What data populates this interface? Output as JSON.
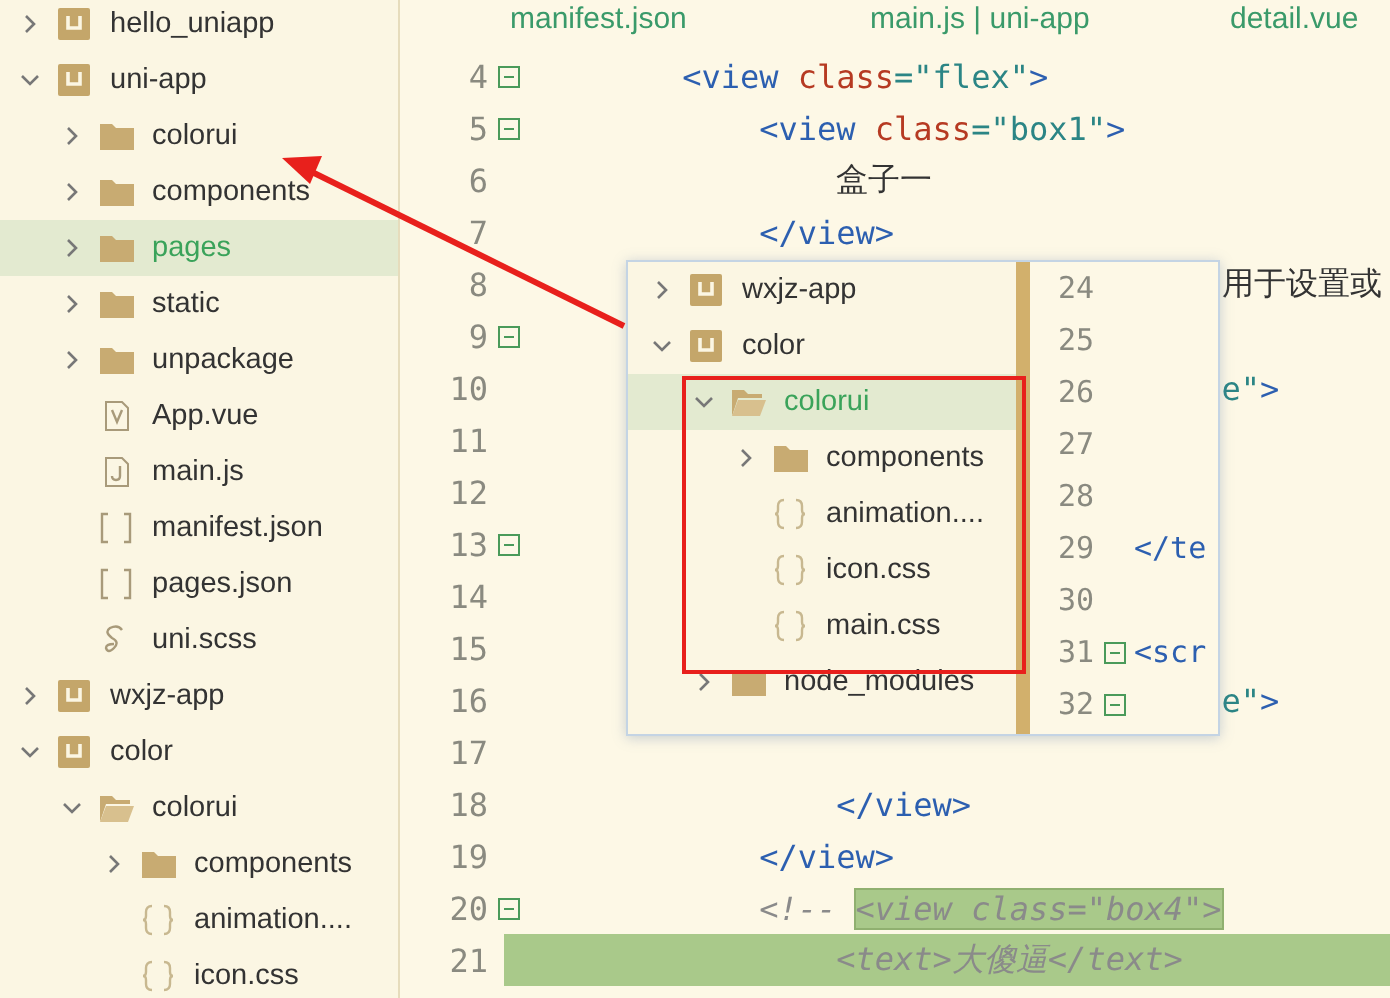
{
  "sidebar": {
    "tree": [
      {
        "label": "hello_uniapp",
        "kind": "project",
        "expanded": false,
        "selected": false
      },
      {
        "label": "uni-app",
        "kind": "project",
        "expanded": true,
        "selected": false,
        "children": [
          {
            "label": "colorui",
            "kind": "folder",
            "expanded": false,
            "selected": false
          },
          {
            "label": "components",
            "kind": "folder",
            "expanded": false,
            "selected": false
          },
          {
            "label": "pages",
            "kind": "folder",
            "expanded": false,
            "selected": true
          },
          {
            "label": "static",
            "kind": "folder",
            "expanded": false,
            "selected": false
          },
          {
            "label": "unpackage",
            "kind": "folder",
            "expanded": false,
            "selected": false
          },
          {
            "label": "App.vue",
            "kind": "vue",
            "selected": false
          },
          {
            "label": "main.js",
            "kind": "js",
            "selected": false
          },
          {
            "label": "manifest.json",
            "kind": "json",
            "selected": false
          },
          {
            "label": "pages.json",
            "kind": "json",
            "selected": false
          },
          {
            "label": "uni.scss",
            "kind": "scss",
            "selected": false
          }
        ]
      },
      {
        "label": "wxjz-app",
        "kind": "project",
        "expanded": false,
        "selected": false
      },
      {
        "label": "color",
        "kind": "project",
        "expanded": true,
        "selected": false,
        "children": [
          {
            "label": "colorui",
            "kind": "folder",
            "expanded": true,
            "selected": false,
            "children": [
              {
                "label": "components",
                "kind": "folder",
                "expanded": false,
                "selected": false
              },
              {
                "label": "animation....",
                "kind": "css",
                "selected": false
              },
              {
                "label": "icon.css",
                "kind": "css",
                "selected": false
              }
            ]
          }
        ]
      }
    ]
  },
  "editor": {
    "tabs": [
      {
        "label": "manifest.json"
      },
      {
        "label": "main.js | uni-app"
      },
      {
        "label": "detail.vue"
      }
    ],
    "lines": [
      {
        "number": "4",
        "fold": true,
        "tokens": [
          {
            "kind": "tag",
            "text": "        <view "
          },
          {
            "kind": "attr",
            "text": "class"
          },
          {
            "kind": "str",
            "text": "=\"flex\""
          },
          {
            "kind": "tag",
            "text": ">"
          }
        ]
      },
      {
        "number": "5",
        "fold": true,
        "tokens": [
          {
            "kind": "tag",
            "text": "            <view "
          },
          {
            "kind": "attr",
            "text": "class"
          },
          {
            "kind": "str",
            "text": "=\"box1\""
          },
          {
            "kind": "tag",
            "text": ">"
          }
        ]
      },
      {
        "number": "6",
        "fold": false,
        "tokens": [
          {
            "kind": "text",
            "text": "                盒子一"
          }
        ]
      },
      {
        "number": "7",
        "fold": false,
        "tokens": [
          {
            "kind": "tag",
            "text": "            </view>"
          }
        ]
      },
      {
        "number": "8",
        "fold": false,
        "tokens": [
          {
            "kind": "text",
            "text": "                                    用于设置或"
          }
        ]
      },
      {
        "number": "9",
        "fold": true
      },
      {
        "number": "10",
        "fold": false,
        "tokens": [
          {
            "kind": "str",
            "text": "                                    e\""
          },
          {
            "kind": "tag",
            "text": ">"
          }
        ]
      },
      {
        "number": "11",
        "fold": false
      },
      {
        "number": "12",
        "fold": false
      },
      {
        "number": "13",
        "fold": true
      },
      {
        "number": "14",
        "fold": false
      },
      {
        "number": "15",
        "fold": false
      },
      {
        "number": "16",
        "fold": false,
        "tokens": [
          {
            "kind": "str",
            "text": "                                    e\""
          },
          {
            "kind": "tag",
            "text": ">"
          }
        ]
      },
      {
        "number": "17",
        "fold": false
      },
      {
        "number": "18",
        "fold": false,
        "tokens": [
          {
            "kind": "tag",
            "text": "                </view>"
          }
        ]
      },
      {
        "number": "19",
        "fold": false,
        "tokens": [
          {
            "kind": "tag",
            "text": "            </view>"
          }
        ]
      },
      {
        "number": "20",
        "fold": true,
        "tokens": [
          {
            "kind": "comment",
            "text": "            <!-- "
          },
          {
            "kind": "comment-mark",
            "text": "<view class=\"box4\">"
          }
        ]
      },
      {
        "number": "21",
        "fold": false,
        "highlight": true,
        "tokens": [
          {
            "kind": "comment",
            "text": "                <text>大傻逼</text>"
          }
        ]
      }
    ]
  },
  "popup": {
    "tree": [
      {
        "label": "wxjz-app",
        "kind": "project",
        "expanded": false,
        "selected": false
      },
      {
        "label": "color",
        "kind": "project",
        "expanded": true,
        "selected": false,
        "children": [
          {
            "label": "colorui",
            "kind": "folder",
            "expanded": true,
            "selected": true,
            "children": [
              {
                "label": "components",
                "kind": "folder",
                "expanded": false,
                "selected": false
              },
              {
                "label": "animation....",
                "kind": "css",
                "selected": false
              },
              {
                "label": "icon.css",
                "kind": "css",
                "selected": false
              },
              {
                "label": "main.css",
                "kind": "css",
                "selected": false
              }
            ]
          },
          {
            "label": "node_modules",
            "kind": "folder",
            "expanded": false,
            "selected": false
          }
        ]
      }
    ],
    "lines": [
      {
        "number": "24",
        "fold": false
      },
      {
        "number": "25",
        "fold": false
      },
      {
        "number": "26",
        "fold": false
      },
      {
        "number": "27",
        "fold": false
      },
      {
        "number": "28",
        "fold": false
      },
      {
        "number": "29",
        "fold": false,
        "text": "</te"
      },
      {
        "number": "30",
        "fold": false
      },
      {
        "number": "31",
        "fold": true,
        "text": "<scr"
      },
      {
        "number": "32",
        "fold": true
      }
    ]
  }
}
